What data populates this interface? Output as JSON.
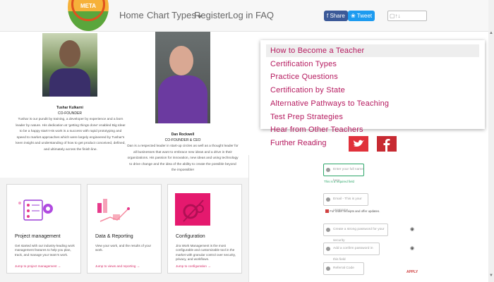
{
  "header": {
    "logo_text": "META",
    "nav": [
      {
        "label": "Home"
      },
      {
        "label": "Chart Types",
        "caret": "▾"
      },
      {
        "label": "Register"
      },
      {
        "label": "Log in"
      },
      {
        "label": "FAQ"
      }
    ],
    "share_label": "Share",
    "tweet_label": "Tweet",
    "search_text": "▢↑↓"
  },
  "team": [
    {
      "name": "Tushar Kulkarni",
      "title": "CO-FOUNDER",
      "bio": "Tushar is our pundit by training, a developer by experience and a born leader by nature. His dedication at ‘getting things done’ enabled Big Idea! to be a happy start! His work is a success with rapid prototyping and speed to market approaches which were largely engineered by Tushar's keen insight and understanding of how to get product conceived, defined, and ultimately across the finish line."
    },
    {
      "name": "Dan Rockwell",
      "title": "CO-FOUNDER & CEO",
      "bio": "Dan is a respected leader in start-up circles as well as a thought leader for all businesses that want to embrace new ideas and a drive in their organizations. His passion for innovation, new ideas and using technology to drive change and the idea of the ability to create the possible beyond the impossible!"
    }
  ],
  "cards": [
    {
      "title": "Project management",
      "desc": "Get started with our industry-leading work management features to help you plan, track, and manage your team's work.",
      "link": "Jump to project management →"
    },
    {
      "title": "Data & Reporting",
      "desc": "View your work, and the results of your work.",
      "link": "Jump to views and reporting →"
    },
    {
      "title": "Configuration",
      "desc": "Jira Work Management is the most configurable and customizable tool in the market with granular control over security, privacy, and workflows.",
      "link": "Jump to configuration →"
    }
  ],
  "menu": {
    "items": [
      {
        "label": "How to Become a Teacher"
      },
      {
        "label": "Certification Types"
      },
      {
        "label": "Practice Questions"
      },
      {
        "label": "Certification by State"
      },
      {
        "label": "Alternative Pathways to Teaching"
      },
      {
        "label": "Test Prep Strategies"
      },
      {
        "label": "Hear from Other Teachers"
      }
    ],
    "further_reading": "Further Reading"
  },
  "social": {
    "twitter_color": "#e0313b",
    "facebook_color": "#c72a32"
  },
  "form": {
    "name_placeholder": "Enter your full name here",
    "name_note": "This is a required field",
    "email_placeholder": "Email - This is your username",
    "email_note": "For order receipts and offer updates.",
    "password_placeholder": "Create a strong password for your security",
    "confirm_placeholder": "Add a confirm password in this field",
    "referral_placeholder": "Referral Code",
    "apply_label": "APPLY"
  },
  "colors": {
    "accent": "#b5195e",
    "brand_orange": "#f6b13a",
    "brand_green": "#5aa63c"
  }
}
